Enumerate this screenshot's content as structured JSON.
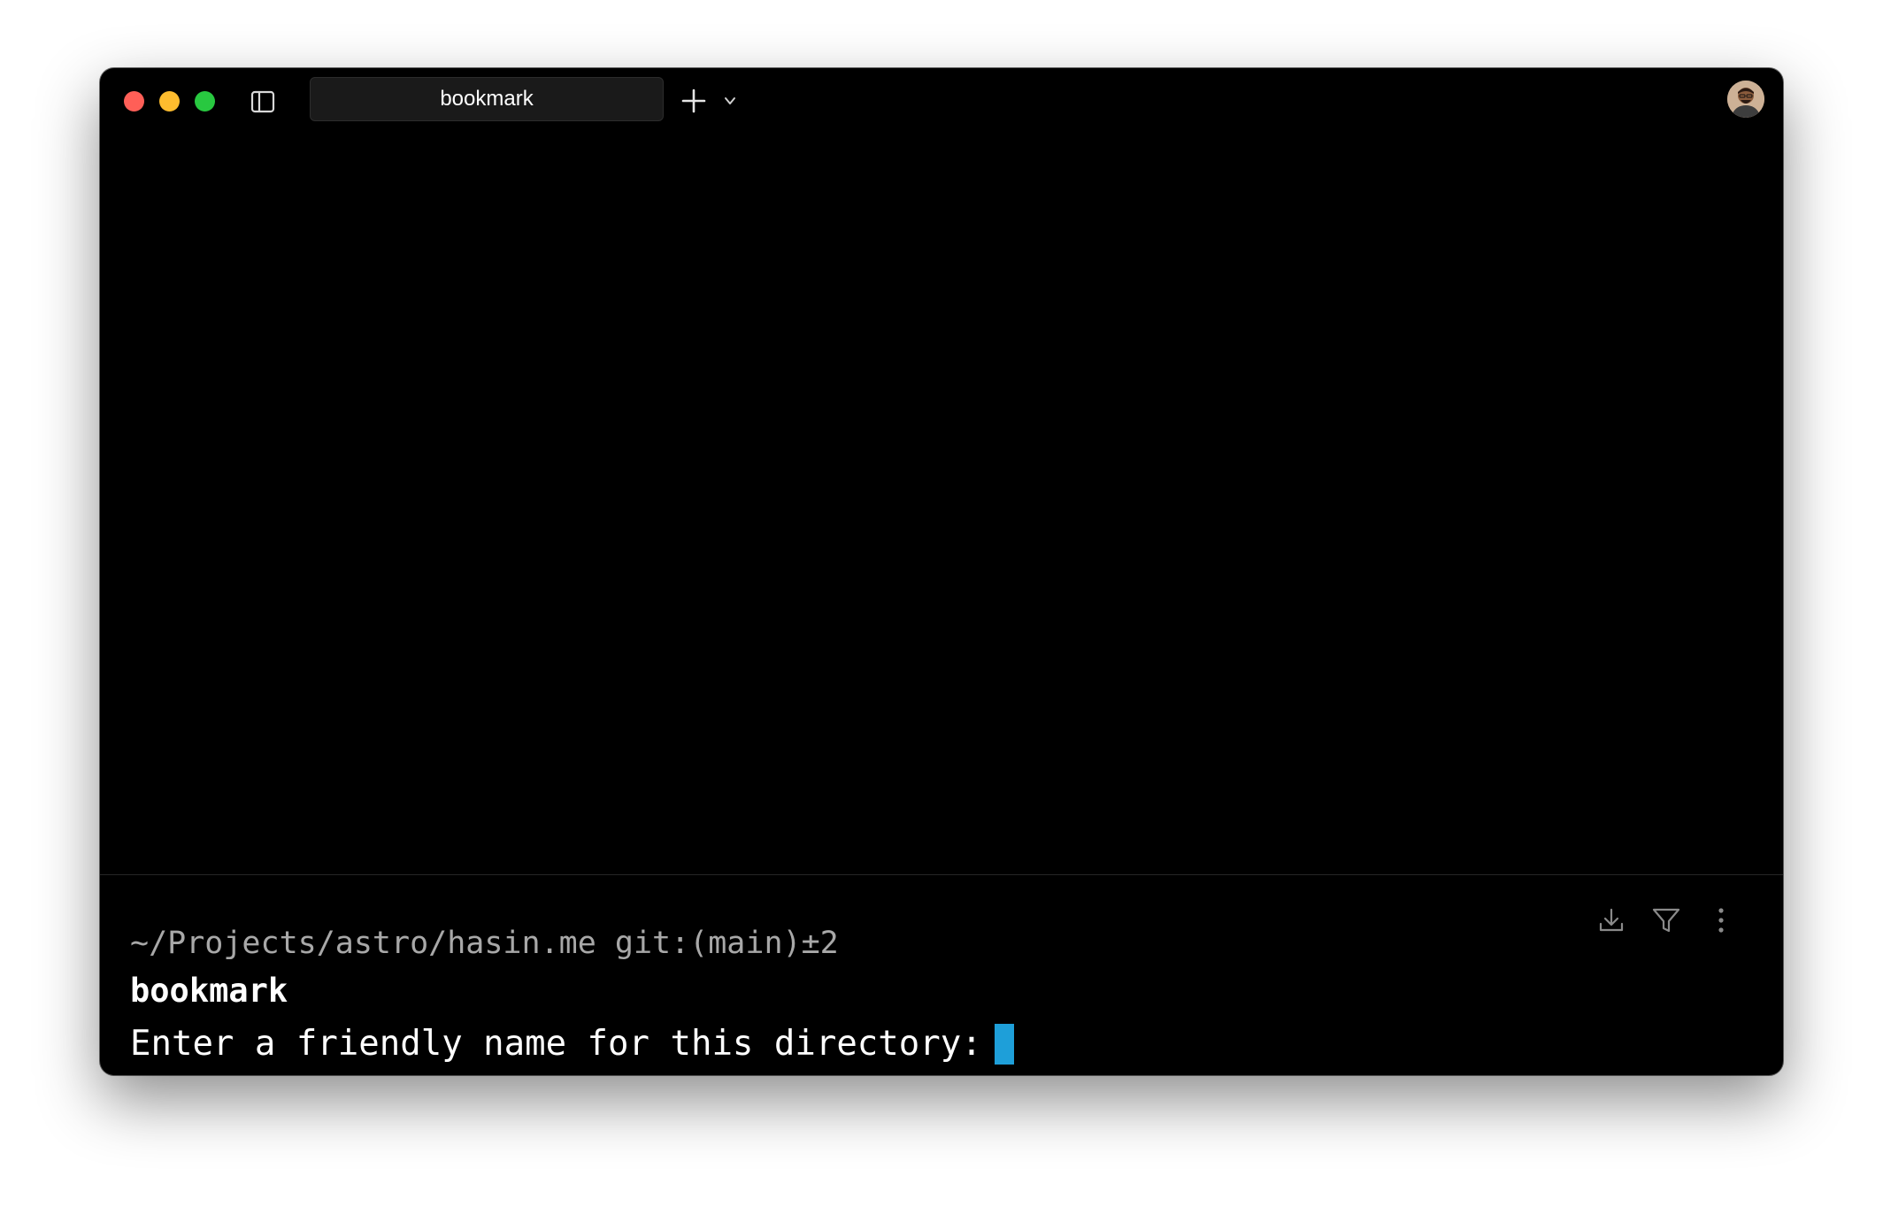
{
  "window": {
    "tab_title": "bookmark"
  },
  "colors": {
    "close": "#ff5f57",
    "minimize": "#febc2e",
    "maximize": "#28c840",
    "cursor": "#1e9fd9",
    "background": "#000000"
  },
  "icons": {
    "sidebar": "sidebar-toggle-icon",
    "new_tab": "plus-icon",
    "tab_menu": "chevron-down-icon",
    "save": "download-icon",
    "filter": "filter-icon",
    "more": "vertical-ellipsis-icon"
  },
  "terminal": {
    "prompt_path": "~/Projects/astro/hasin.me git:(main)±2",
    "command": "bookmark",
    "prompt_text": "Enter a friendly name for this directory:",
    "input_value": ""
  }
}
